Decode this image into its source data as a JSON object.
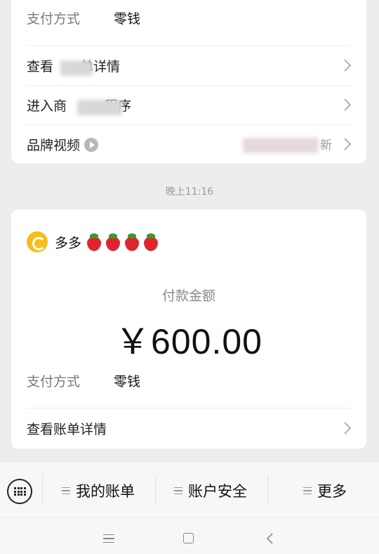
{
  "top_card": {
    "payment_method_label": "支付方式",
    "payment_method_value": "零钱",
    "rows": [
      {
        "label_a": "查看",
        "label_b": "单详情"
      },
      {
        "label_a": "进入商",
        "label_b": "程序"
      },
      {
        "label_a": "品牌视频",
        "trailing": "新"
      }
    ]
  },
  "timestamp": "晚上11:16",
  "main_card": {
    "merchant_name": "多多",
    "merchant_emoji_count": 4,
    "amount_label": "付款金额",
    "amount": "￥600.00",
    "payment_method_label": "支付方式",
    "payment_method_value": "零钱",
    "bill_detail_label": "查看账单详情"
  },
  "bottom_menu": {
    "items": [
      "我的账单",
      "账户安全",
      "更多"
    ]
  },
  "icons": {
    "keyboard": "keyboard-icon",
    "chevron": "chevron-right-icon",
    "play": "play-icon",
    "nav_menu": "menu-icon",
    "nav_home": "home-icon",
    "nav_back": "back-icon"
  }
}
